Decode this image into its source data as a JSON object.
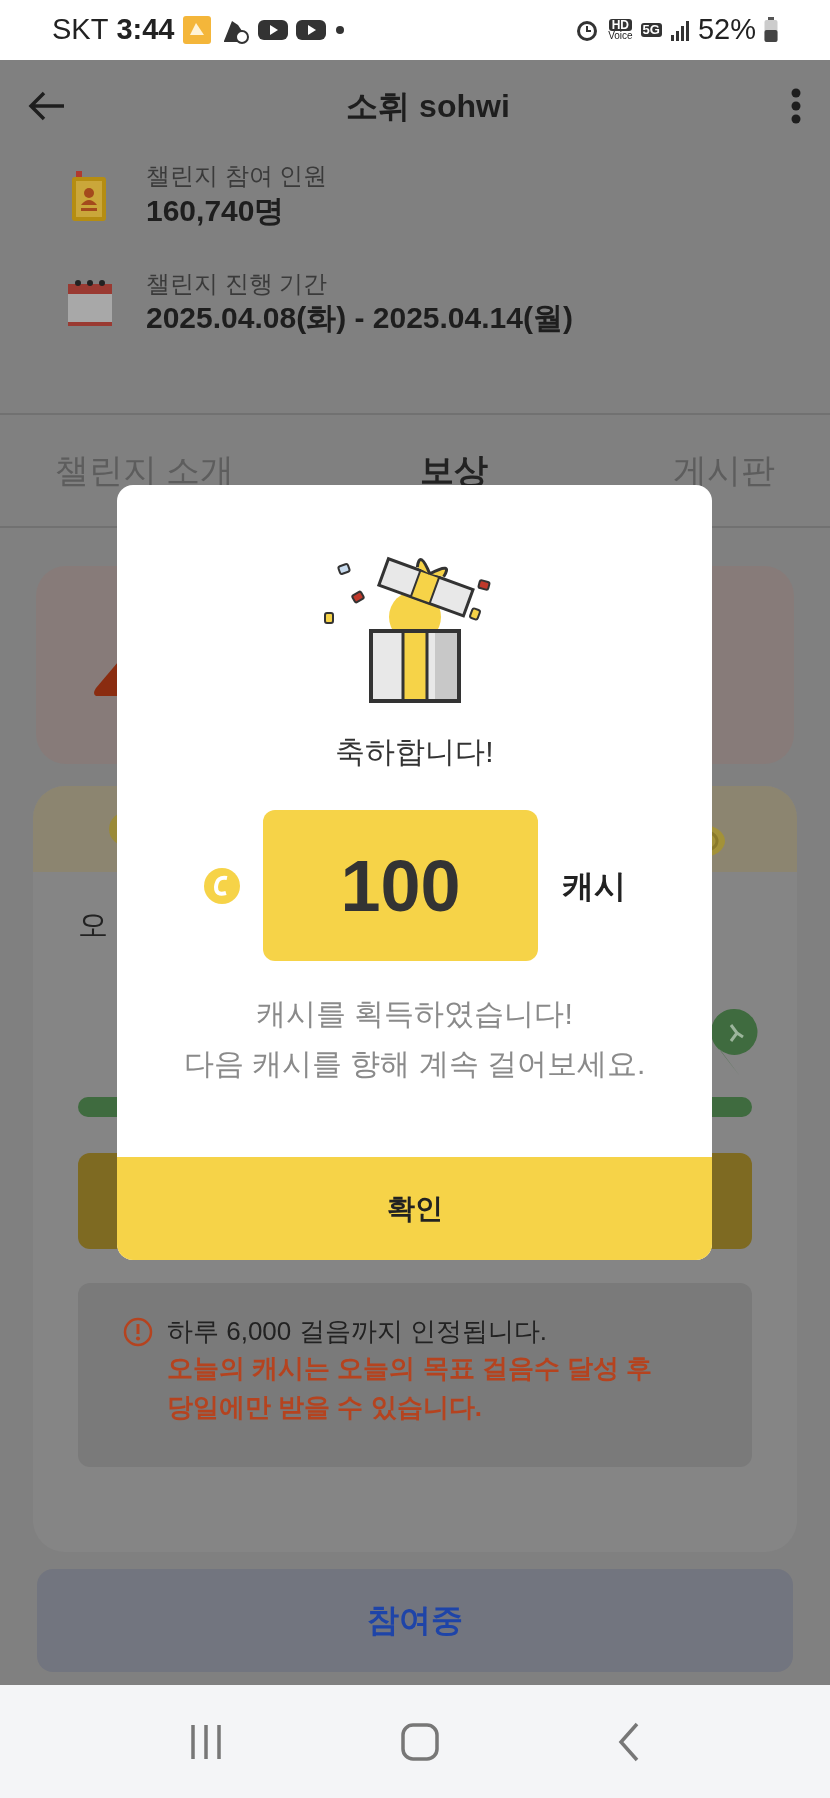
{
  "status_bar": {
    "carrier": "SKT",
    "time": "3:44",
    "indicators": [
      "HD",
      "Voice",
      "5G"
    ],
    "battery": "52%"
  },
  "header": {
    "title": "소휘 sohwi"
  },
  "info": [
    {
      "kind": "participants",
      "label": "챌린지 참여 인원",
      "value": "160,740명"
    },
    {
      "kind": "period",
      "label": "챌린지 진행 기간",
      "value": "2025.04.08(화) - 2025.04.14(월)"
    }
  ],
  "tabs": [
    {
      "label": "챌린지 소개",
      "selected": false
    },
    {
      "label": "보상",
      "selected": true
    },
    {
      "label": "게시판",
      "selected": false
    }
  ],
  "reward_card": {
    "title": "오"
  },
  "notice": {
    "text": "하루 6,000 걸음까지 인정됩니다.",
    "warning_lines": [
      "오늘의 캐시는 오늘의 목표 걸음수 달성 후",
      "당일에만 받을 수 있습니다."
    ]
  },
  "join_button": "참여중",
  "modal": {
    "title": "축하합니다!",
    "amount": "100",
    "unit": "캐시",
    "message_lines": [
      "캐시를 획득하였습니다!",
      "다음 캐시를 향해 계속 걸어보세요."
    ],
    "confirm": "확인"
  }
}
